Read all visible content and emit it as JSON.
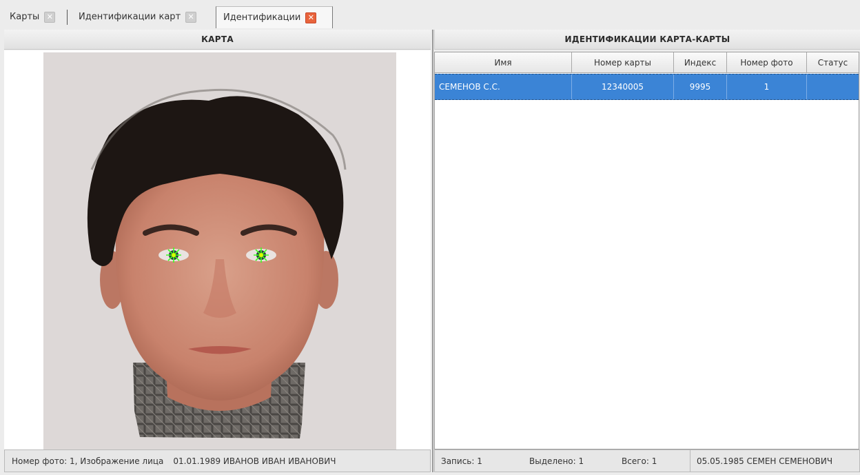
{
  "tabs": [
    {
      "label": "Карты"
    },
    {
      "label": "Идентификации карт"
    },
    {
      "label": "Идентификации"
    }
  ],
  "left_panel": {
    "title": "КАРТА",
    "status": {
      "photo_info": "Номер фото: 1, Изображение лица",
      "card_holder": "01.01.1989 ИВАНОВ ИВАН ИВАНОВИЧ"
    }
  },
  "right_panel": {
    "title": "ИДЕНТИФИКАЦИИ КАРТА-КАРТЫ",
    "columns": [
      "Имя",
      "Номер карты",
      "Индекс",
      "Номер фото",
      "Статус"
    ],
    "rows": [
      {
        "name": "СЕМЕНОВ С.С.",
        "card_number": "12340005",
        "index": "9995",
        "photo_number": "1",
        "status": ""
      }
    ],
    "status": {
      "record": "Запись: 1",
      "selected": "Выделено: 1",
      "total": "Всего: 1",
      "match_holder": "05.05.1985  СЕМЕН СЕМЕНОВИЧ"
    }
  },
  "colors": {
    "selection": "#3b84d6",
    "active_close": "#e8643c",
    "eye_marker": "#3cff20"
  }
}
